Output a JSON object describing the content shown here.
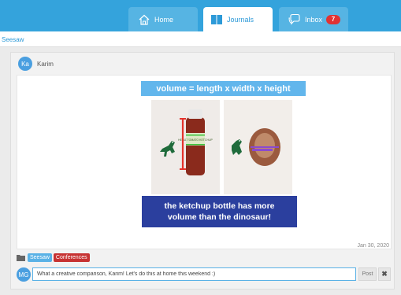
{
  "nav": {
    "tabs": [
      {
        "label": "Home",
        "icon": "home-icon"
      },
      {
        "label": "Journals",
        "icon": "journal-icon"
      },
      {
        "label": "Inbox",
        "icon": "chat-icon",
        "badge": "7"
      }
    ],
    "active_tab": "Journals",
    "accent": "#34a3dc"
  },
  "breadcrumb": {
    "label": "Seesaw"
  },
  "post": {
    "author": {
      "initials": "Ka",
      "name": "Karim"
    },
    "image": {
      "title": "volume = length x width x height",
      "caption_line1": "the ketchup bottle has more",
      "caption_line2": "volume than the dinosaur!",
      "bottle_label": "HEINZ TOMATO KETCHUP"
    },
    "date": "Jan 30, 2020",
    "tags": [
      {
        "label": "Seesaw",
        "color": "#5ab2e6"
      },
      {
        "label": "Conferences",
        "color": "#c73333"
      }
    ]
  },
  "comment": {
    "avatar_initials": "MG",
    "value": "What a creative comparison, Karim! Let's do this at home this weekend :)",
    "post_label": "Post",
    "close_label": "✖"
  }
}
